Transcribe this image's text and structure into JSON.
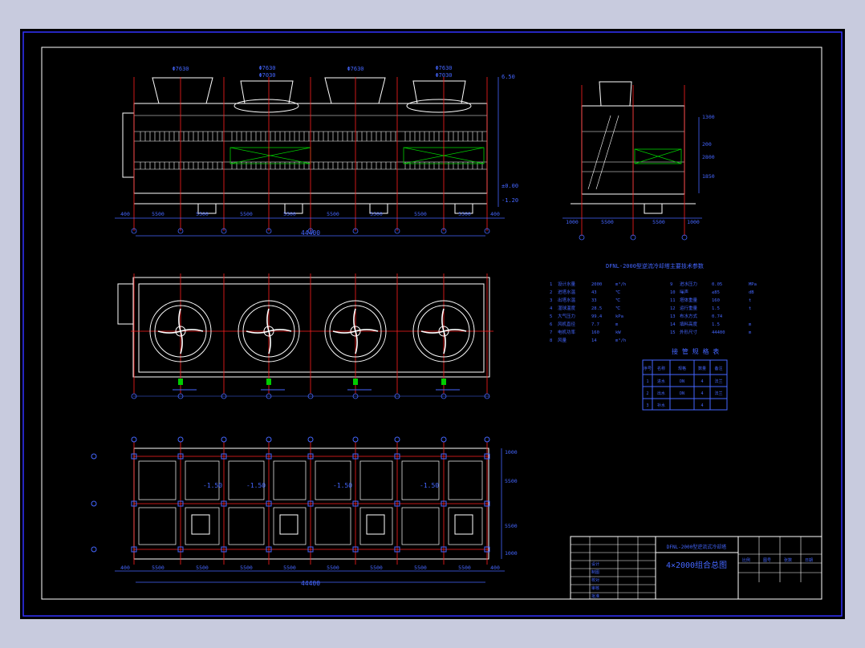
{
  "viewport": {
    "background": "#000000",
    "frame_color": "#3333ff"
  },
  "colors": {
    "outline": "#ffffff",
    "axis": "#ff2020",
    "dim": "#4466ff",
    "fill_green": "#00cc00",
    "pipe_green": "#00aa00"
  },
  "elevation": {
    "top_labels": [
      "Φ7630",
      "Φ7630",
      "Φ7630",
      "Φ7630"
    ],
    "top_labels2": [
      "Φ7030",
      "Φ7030"
    ],
    "bottom_dims": [
      "400",
      "5500",
      "5500",
      "5500",
      "5500",
      "5500",
      "5500",
      "5500",
      "5500",
      "400"
    ],
    "overall": "44400",
    "levels": [
      "6.50",
      "±0.00",
      "-1.20"
    ]
  },
  "side_view": {
    "bottom_dims": [
      "1000",
      "5500",
      "5500",
      "1000"
    ],
    "right_dims": [
      "1300",
      "200",
      "2800",
      "1850"
    ]
  },
  "plan": {
    "fan_count": 4
  },
  "foundation": {
    "bottom_dims": [
      "400",
      "5500",
      "5500",
      "5500",
      "5500",
      "5500",
      "5500",
      "5500",
      "5500",
      "400"
    ],
    "overall": "44400",
    "right_dims": [
      "1000",
      "5500",
      "5500",
      "1000"
    ],
    "levels": [
      "-1.50",
      "-1.50",
      "-1.50",
      "-1.50"
    ]
  },
  "spec_table": {
    "title": "DFNL-2000型逆流冷却塔主要技术参数",
    "rows_left": [
      [
        "1",
        "设计水量",
        "2000",
        "m³/h"
      ],
      [
        "2",
        "进塔水温",
        "43",
        "℃"
      ],
      [
        "3",
        "出塔水温",
        "33",
        "℃"
      ],
      [
        "4",
        "湿球温度",
        "28.5",
        "℃"
      ],
      [
        "5",
        "大气压力",
        "99.4",
        "kPa"
      ],
      [
        "6",
        "风机直径",
        "7.7",
        "m"
      ],
      [
        "7",
        "电机功率",
        "160",
        "kW"
      ],
      [
        "8",
        "风量",
        "14",
        "m³/h"
      ]
    ],
    "rows_right": [
      [
        "9",
        "进水压力",
        "0.05",
        "MPa"
      ],
      [
        "10",
        "噪声",
        "≤85",
        "dB"
      ],
      [
        "11",
        "塔体重量",
        "160",
        "t"
      ],
      [
        "12",
        "运行重量",
        "1.5",
        "t"
      ],
      [
        "13",
        "布水方式",
        "0.74",
        ""
      ],
      [
        "14",
        "填料高度",
        "1.5",
        "m"
      ],
      [
        "15",
        "外形尺寸",
        "44400",
        "m"
      ]
    ]
  },
  "pipe_table": {
    "title": "接 管 规 格 表",
    "headers": [
      "序号",
      "名称",
      "规格",
      "数量",
      "备注"
    ],
    "rows": [
      [
        "1",
        "进水",
        "DN",
        "4",
        "法兰"
      ],
      [
        "2",
        "出水",
        "DN",
        "4",
        "法兰"
      ],
      [
        "3",
        "补水",
        "",
        "4",
        ""
      ]
    ]
  },
  "title_block": {
    "project": "DFNL-2000型逆流式冷却塔",
    "drawing_title": "4×2000组合总图",
    "left_labels": [
      "设计",
      "制图",
      "校对",
      "审核",
      "批准"
    ],
    "right_labels": [
      "比例",
      "图号",
      "张数",
      "日期"
    ]
  }
}
